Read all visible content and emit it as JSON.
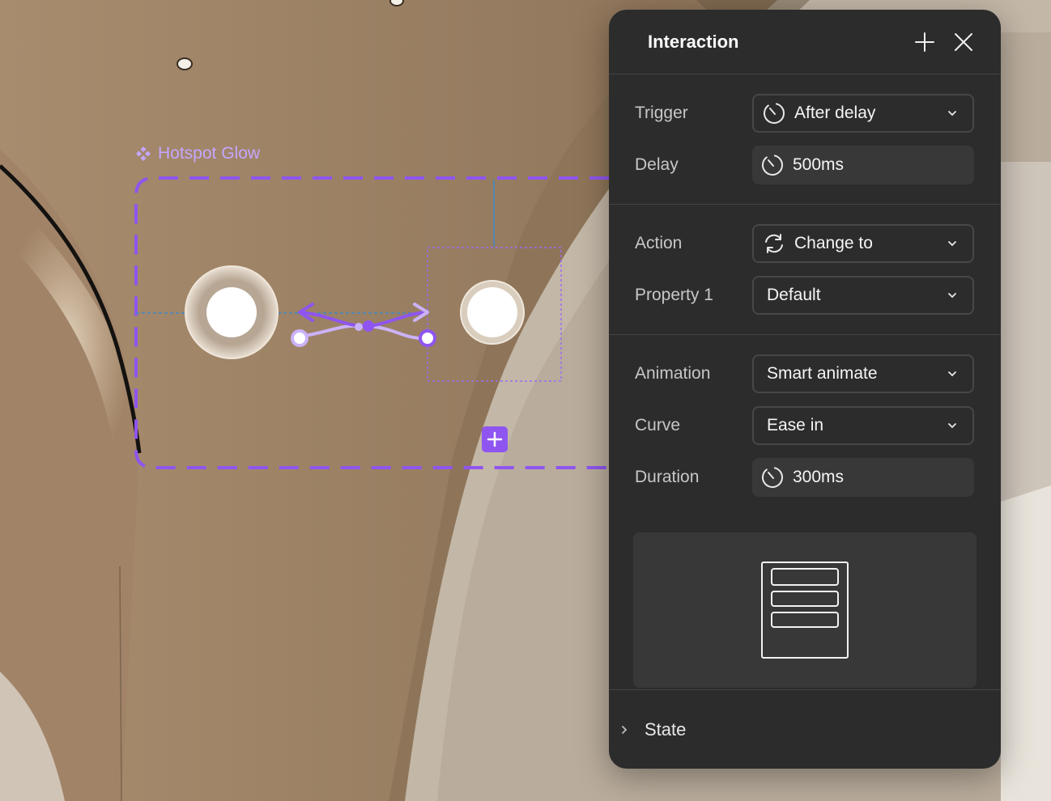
{
  "canvas": {
    "component_name": "Hotspot Glow",
    "accent_color": "#8f55f0",
    "icons": {
      "component": "component-diamond-icon",
      "add_variant": "plus-icon"
    }
  },
  "panel": {
    "title": "Interaction",
    "header_icons": [
      "plus-icon",
      "close-icon"
    ],
    "trigger": {
      "label": "Trigger",
      "value": "After delay",
      "icon": "timer-icon"
    },
    "delay": {
      "label": "Delay",
      "value": "500ms",
      "icon": "timer-icon"
    },
    "action": {
      "label": "Action",
      "value": "Change to",
      "icon": "refresh-icon"
    },
    "property1": {
      "label": "Property 1",
      "value": "Default"
    },
    "animation": {
      "label": "Animation",
      "value": "Smart animate"
    },
    "curve": {
      "label": "Curve",
      "value": "Ease in"
    },
    "duration": {
      "label": "Duration",
      "value": "300ms",
      "icon": "timer-icon"
    },
    "preview_icon": "layout-preview-icon",
    "state": {
      "label": "State",
      "icon": "chevron-right-icon"
    }
  }
}
